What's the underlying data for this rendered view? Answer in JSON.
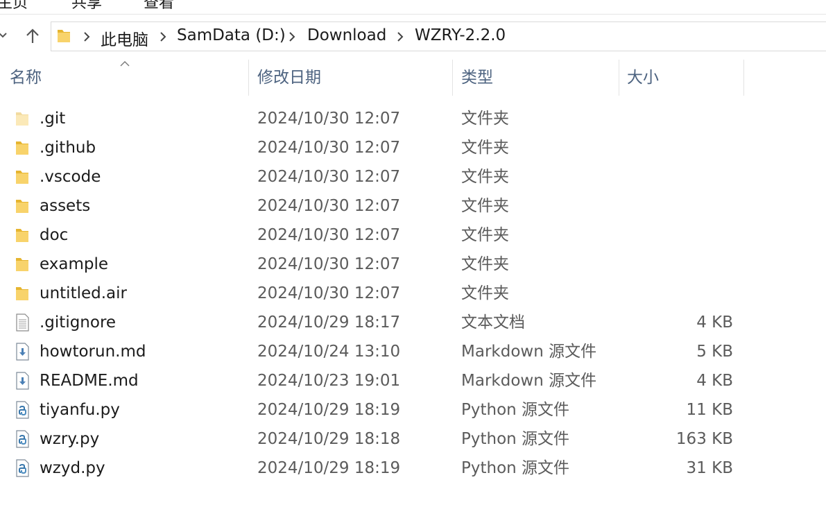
{
  "ribbon": {
    "tabs": [
      "主页",
      "共享",
      "查看"
    ]
  },
  "breadcrumb": [
    "此电脑",
    "SamData (D:)",
    "Download",
    "WZRY-2.2.0"
  ],
  "columns": {
    "name": "名称",
    "date": "修改日期",
    "type": "类型",
    "size": "大小"
  },
  "files": [
    {
      "name": ".git",
      "date": "2024/10/30 12:07",
      "type": "文件夹",
      "size": "",
      "icon": "folder-faded-icon"
    },
    {
      "name": ".github",
      "date": "2024/10/30 12:07",
      "type": "文件夹",
      "size": "",
      "icon": "folder-icon"
    },
    {
      "name": ".vscode",
      "date": "2024/10/30 12:07",
      "type": "文件夹",
      "size": "",
      "icon": "folder-icon"
    },
    {
      "name": "assets",
      "date": "2024/10/30 12:07",
      "type": "文件夹",
      "size": "",
      "icon": "folder-icon"
    },
    {
      "name": "doc",
      "date": "2024/10/30 12:07",
      "type": "文件夹",
      "size": "",
      "icon": "folder-icon"
    },
    {
      "name": "example",
      "date": "2024/10/30 12:07",
      "type": "文件夹",
      "size": "",
      "icon": "folder-icon"
    },
    {
      "name": "untitled.air",
      "date": "2024/10/30 12:07",
      "type": "文件夹",
      "size": "",
      "icon": "folder-icon"
    },
    {
      "name": ".gitignore",
      "date": "2024/10/29 18:17",
      "type": "文本文档",
      "size": "4 KB",
      "icon": "text-file-icon"
    },
    {
      "name": "howtorun.md",
      "date": "2024/10/24 13:10",
      "type": "Markdown 源文件",
      "size": "5 KB",
      "icon": "markdown-file-icon"
    },
    {
      "name": "README.md",
      "date": "2024/10/23 19:01",
      "type": "Markdown 源文件",
      "size": "4 KB",
      "icon": "markdown-file-icon"
    },
    {
      "name": "tiyanfu.py",
      "date": "2024/10/29 18:19",
      "type": "Python 源文件",
      "size": "11 KB",
      "icon": "python-file-icon"
    },
    {
      "name": "wzry.py",
      "date": "2024/10/29 18:18",
      "type": "Python 源文件",
      "size": "163 KB",
      "icon": "python-file-icon"
    },
    {
      "name": "wzyd.py",
      "date": "2024/10/29 18:19",
      "type": "Python 源文件",
      "size": "31 KB",
      "icon": "python-file-icon"
    }
  ],
  "colors": {
    "folder": "#f8d36b",
    "folder_dark": "#e6b530",
    "header_text": "#4d6380",
    "secondary_text": "#5b5b5b",
    "python_blue": "#3776ab",
    "markdown_blue": "#4a7fb5"
  }
}
